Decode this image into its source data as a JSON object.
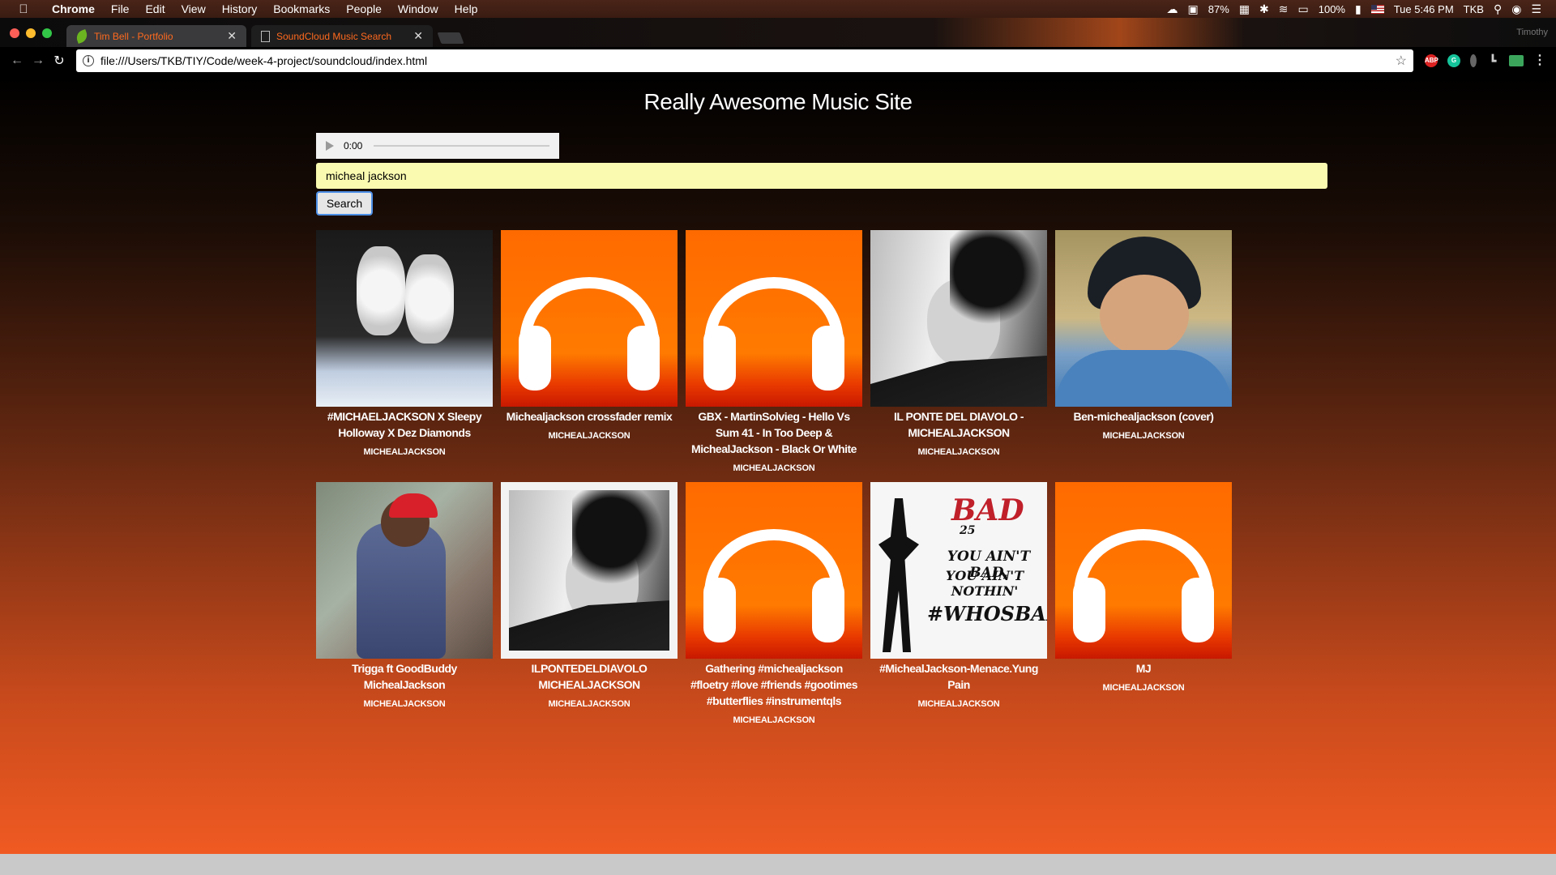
{
  "menubar": {
    "app": "Chrome",
    "items": [
      "File",
      "Edit",
      "View",
      "History",
      "Bookmarks",
      "People",
      "Window",
      "Help"
    ],
    "status": {
      "mem": "87%",
      "battery": "100%",
      "clock": "Tue 5:46 PM",
      "user": "TKB"
    }
  },
  "browser": {
    "tabs": [
      {
        "label": "Tim Bell - Portfolio",
        "icon": "leaf-icon",
        "active": false
      },
      {
        "label": "SoundCloud Music Search",
        "icon": "document-icon",
        "active": true
      }
    ],
    "profile": "Timothy",
    "url": "file:///Users/TKB/TIY/Code/week-4-project/soundcloud/index.html",
    "extensions": [
      "ABP",
      "G"
    ]
  },
  "page": {
    "title": "Really Awesome Music Site",
    "player": {
      "time": "0:00"
    },
    "search": {
      "value": "micheal jackson",
      "button_label": "Search"
    },
    "results": [
      {
        "title": "#MICHAELJACKSON X Sleepy Holloway X Dez Diamonds",
        "user": "MICHEALJACKSON",
        "art": "shoes"
      },
      {
        "title": "Michealjackson crossfader remix",
        "user": "MICHEALJACKSON",
        "art": "headphones"
      },
      {
        "title": "GBX - MartinSolvieg - Hello Vs Sum 41 - In Too Deep & MichealJackson - Black Or White",
        "user": "MICHEALJACKSON",
        "art": "headphones"
      },
      {
        "title": "IL PONTE DEL DIAVOLO - MICHEALJACKSON",
        "user": "MICHEALJACKSON",
        "art": "mj-portrait"
      },
      {
        "title": "Ben-michealjackson (cover)",
        "user": "MICHEALJACKSON",
        "art": "boy-helmet"
      },
      {
        "title": "Trigga ft GoodBuddy MichealJackson",
        "user": "MICHEALJACKSON",
        "art": "trigga"
      },
      {
        "title": "ILPONTEDELDIAVOLO MICHEALJACKSON",
        "user": "MICHEALJACKSON",
        "art": "mj-portrait-framed"
      },
      {
        "title": "Gathering #michealjackson #floetry #love #friends #gootimes #butterflies #instrumentqls",
        "user": "MICHEALJACKSON",
        "art": "headphones"
      },
      {
        "title": "#MichealJackson-Menace.Yung Pain",
        "user": "MICHEALJACKSON",
        "art": "bad-poster"
      },
      {
        "title": "MJ",
        "user": "MICHEALJACKSON",
        "art": "headphones"
      }
    ],
    "bad_poster_text": {
      "line1": "BAD",
      "line2": "25",
      "line3": "YOU AIN'T BAD,",
      "line4": "YOU AIN'T NOTHIN'",
      "line5": "#WHOSBAD"
    }
  }
}
